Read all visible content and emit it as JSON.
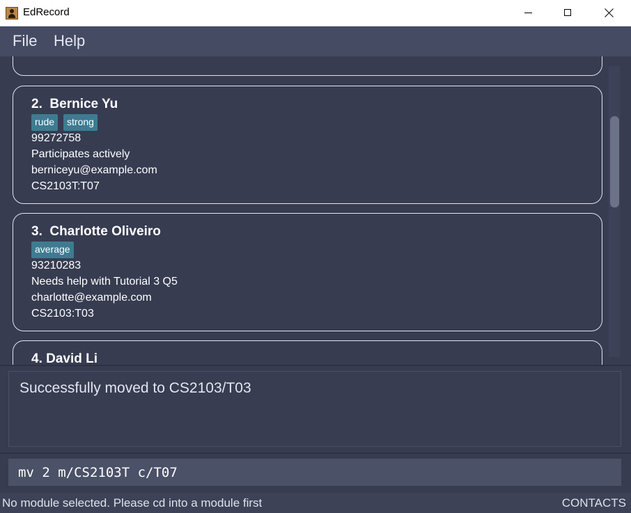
{
  "window": {
    "title": "EdRecord"
  },
  "menu": {
    "items": [
      "File",
      "Help"
    ]
  },
  "person_list": {
    "cards": [
      {
        "index": "2.",
        "name": "Bernice Yu",
        "tags": [
          "rude",
          "strong"
        ],
        "phone": "99272758",
        "info": "Participates actively",
        "email": "berniceyu@example.com",
        "module_group": "CS2103T:T07"
      },
      {
        "index": "3.",
        "name": "Charlotte Oliveiro",
        "tags": [
          "average"
        ],
        "phone": "93210283",
        "info": "Needs help with Tutorial 3 Q5",
        "email": "charlotte@example.com",
        "module_group": "CS2103:T03"
      },
      {
        "index": "4.",
        "name": "David Li"
      }
    ]
  },
  "result_display": {
    "text": "Successfully moved to CS2103/T03"
  },
  "command_box": {
    "value": "mv 2 m/CS2103T c/T07"
  },
  "status_bar": {
    "left": "No module selected. Please cd into a module first",
    "right": "CONTACTS"
  },
  "colors": {
    "background": "#373c51",
    "menubar": "#454b63",
    "tag": "#3e7b91",
    "card_border": "#e3e5ec",
    "command_box": "#4b5167"
  },
  "icons": [
    "app-icon",
    "minimize-icon",
    "maximize-icon",
    "close-icon"
  ]
}
